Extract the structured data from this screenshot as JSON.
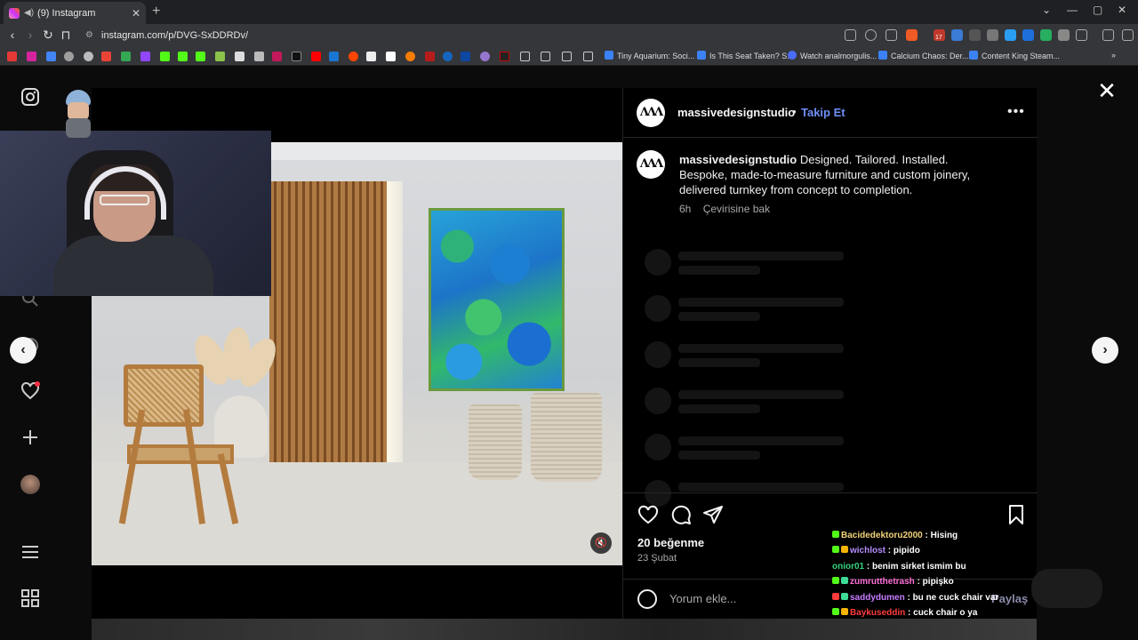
{
  "browser": {
    "tab_title": "(9) Instagram",
    "url": "instagram.com/p/DVG-SxDDRDv/",
    "bookmarks": [
      "Tiny Aquarium: Soci...",
      "Is This Seat Taken? S...",
      "Watch analmorgulis...",
      "Calcium Chaos: Der...",
      "Content King Steam..."
    ],
    "ext_badge": "17"
  },
  "post": {
    "username": "massivedesignstudio",
    "follow_label": "Takip Et",
    "separator": "•",
    "avatar_text": "ΛΛΛ",
    "caption_user": "massivedesignstudio",
    "caption_text": "Designed. Tailored. Installed. Bespoke, made-to-measure furniture and custom joinery, delivered turnkey from concept to completion.",
    "time_ago": "6h",
    "translate_label": "Çevirisine bak",
    "likes": "20 beğenme",
    "date": "23 Şubat",
    "comment_placeholder": "Yorum ekle...",
    "share_label": "Paylaş"
  },
  "chat": [
    {
      "user": "Bacidedektoru2000",
      "msg": ": Hising",
      "color": "#f2d37a"
    },
    {
      "user": "wichlost",
      "msg": ": pipido",
      "color": "#b48cff"
    },
    {
      "user": "onior01",
      "msg": ": benim sirket ismim bu",
      "color": "#36d17c"
    },
    {
      "user": "zumrutthetrash",
      "msg": ": pipişko",
      "color": "#ff6fd8"
    },
    {
      "user": "saddydumen",
      "msg": ": bu ne cuck chair var",
      "color": "#c77dff"
    },
    {
      "user": "Baykuseddin",
      "msg": ": cuck chair o ya",
      "color": "#ff3b3b"
    }
  ],
  "colors": {
    "follow": "#6f8ff8",
    "background": "#000000"
  }
}
